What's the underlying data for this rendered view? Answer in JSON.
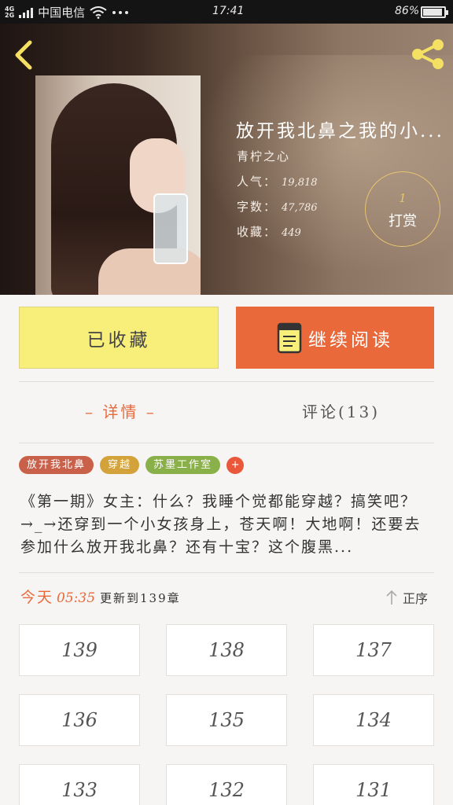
{
  "status_bar": {
    "network": "4G",
    "network2": "2G",
    "carrier": "中国电信",
    "time": "17:41",
    "battery": "86%"
  },
  "icons": {
    "back": "back-chevron-icon",
    "share": "share-icon",
    "read": "book-icon",
    "sort": "up-arrow-icon"
  },
  "book": {
    "title": "放开我北鼻之我的小...",
    "author": "青柠之心",
    "stats": [
      {
        "label": "人气：",
        "value": "19,818"
      },
      {
        "label": "字数：",
        "value": "47,786"
      },
      {
        "label": "收藏：",
        "value": "449"
      }
    ],
    "tip_count": "1",
    "tip_label": "打赏"
  },
  "actions": {
    "favorited_label": "已收藏",
    "continue_label": "继续阅读"
  },
  "tabs": {
    "detail": "– 详情 –",
    "comments": "评论(13)"
  },
  "tags": [
    {
      "label": "放开我北鼻",
      "color": "#c9604a"
    },
    {
      "label": "穿越",
      "color": "#d4a23a"
    },
    {
      "label": "苏墨工作室",
      "color": "#8ab04a"
    }
  ],
  "tag_add": "+",
  "description": "《第一期》女主：什么？我睡个觉都能穿越？搞笑吧？→_→还穿到一个小女孩身上，苍天啊！大地啊！还要去参加什么放开我北鼻？还有十宝？这个腹黑...",
  "update": {
    "day": "今天",
    "time": "05:35",
    "text": "更新到139章"
  },
  "sort_label": "正序",
  "chapters": [
    "139",
    "138",
    "137",
    "136",
    "135",
    "134",
    "133",
    "132",
    "131"
  ],
  "colors": {
    "accent": "#e9693a",
    "favorite_bg": "#f8ee7a",
    "gold": "#e7c56e"
  }
}
